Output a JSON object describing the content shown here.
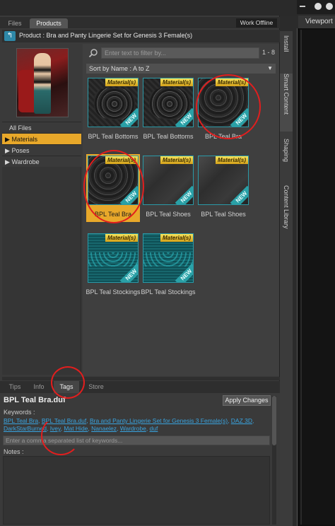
{
  "top_tabs": [
    {
      "label": "Files",
      "active": false
    },
    {
      "label": "Products",
      "active": true
    }
  ],
  "work_offline": "Work Offline",
  "product_bar": {
    "back_icon": "back-arrow-icon",
    "text": "Product : Bra and Panty Lingerie Set for Genesis 3 Female(s)"
  },
  "categories": {
    "all_files": "All Files",
    "items": [
      {
        "label": "Materials",
        "selected": true
      },
      {
        "label": "Poses",
        "selected": false
      },
      {
        "label": "Wardrobe",
        "selected": false
      }
    ]
  },
  "filter": {
    "placeholder": "Enter text to filter by...",
    "range": "1 - 8"
  },
  "sort": {
    "label": "Sort by Name : A to Z"
  },
  "tiles": [
    {
      "badge": "Material(s)",
      "new": "NEW",
      "label": "BPL Teal Bottoms",
      "texture": "lace-teal",
      "selected": false
    },
    {
      "badge": "Material(s)",
      "new": "NEW",
      "label": "BPL Teal Bottoms",
      "texture": "lace-teal",
      "selected": false
    },
    {
      "badge": "Material(s)",
      "new": "NEW",
      "label": "BPL Teal Bra",
      "texture": "lace-dark",
      "selected": false
    },
    {
      "badge": "Material(s)",
      "new": "NEW",
      "label": "BPL Teal Bra",
      "texture": "lace-dark",
      "selected": true
    },
    {
      "badge": "Material(s)",
      "new": "NEW",
      "label": "BPL Teal Shoes",
      "texture": "shoes",
      "selected": false
    },
    {
      "badge": "Material(s)",
      "new": "NEW",
      "label": "BPL Teal Shoes",
      "texture": "shoes",
      "selected": false
    },
    {
      "badge": "Material(s)",
      "new": "NEW",
      "label": "BPL Teal Stockings",
      "texture": "stock",
      "selected": false
    },
    {
      "badge": "Material(s)",
      "new": "NEW",
      "label": "BPL Teal Stockings",
      "texture": "stock",
      "selected": false
    }
  ],
  "side_tabs": [
    "Install",
    "Smart Content",
    "Shaping",
    "Content Library"
  ],
  "viewport_tab": "Viewport",
  "bottom_tabs": [
    {
      "label": "Tips",
      "active": false
    },
    {
      "label": "Info",
      "active": false
    },
    {
      "label": "Tags",
      "active": true
    },
    {
      "label": "Store",
      "active": false
    }
  ],
  "tags_pane": {
    "file_name": "BPL Teal Bra.duf",
    "apply_button": "Apply Changes",
    "keywords_label": "Keywords :",
    "keywords": [
      "BPL Teal Bra",
      "BPL Teal Bra.duf",
      "Bra and Panty Lingerie Set for Genesis 3 Female(s)",
      "DAZ 3D",
      "DarkStarBurned",
      "Ivey",
      "Mat Hide",
      "Nanaelez",
      "Wardrobe",
      "duf"
    ],
    "keyword_placeholder": "Enter a comma separated list of keywords...",
    "notes_label": "Notes :"
  },
  "colors": {
    "selection": "#e8a82a",
    "link": "#39a4e0",
    "annotation": "#e21e1e",
    "accent_teal": "#2a9aa8"
  }
}
